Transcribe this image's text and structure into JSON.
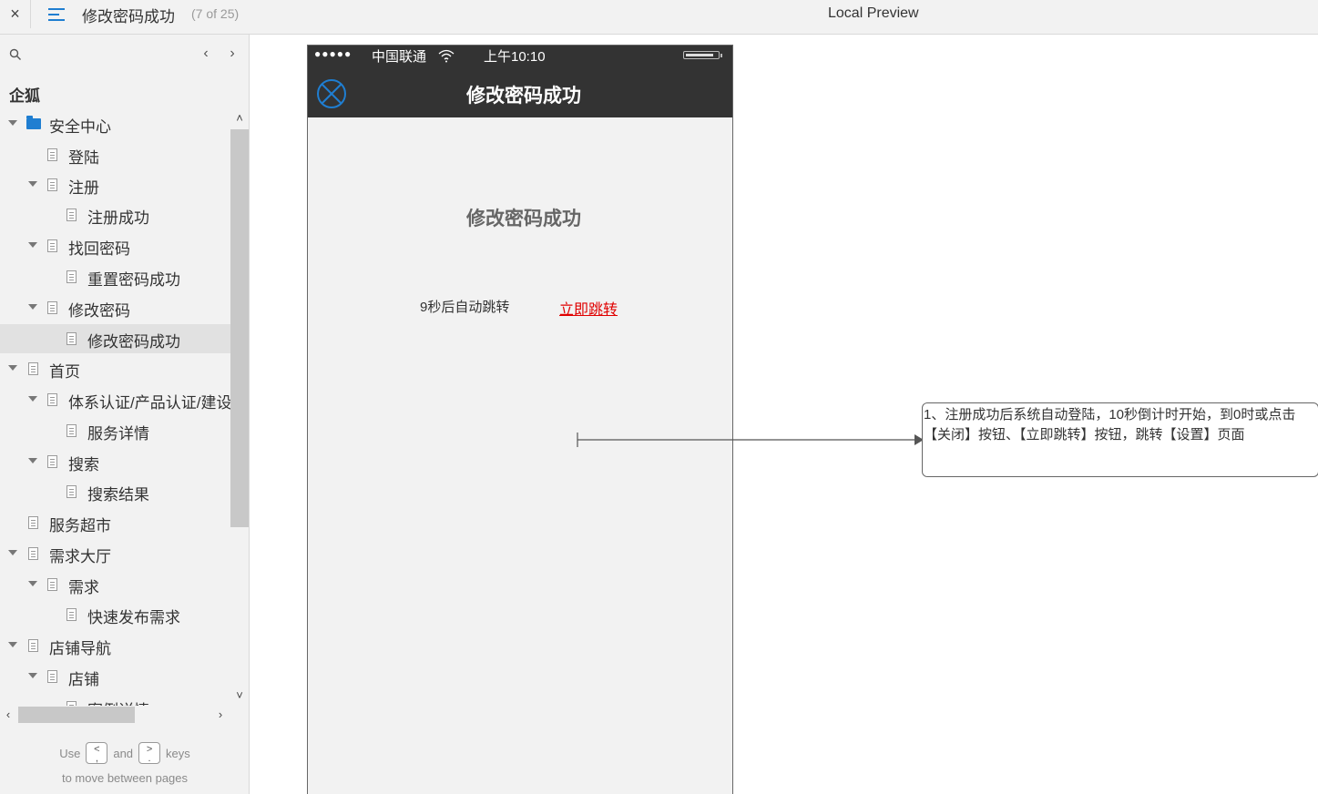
{
  "topbar": {
    "close_label": "×",
    "page_title": "修改密码成功",
    "page_count": "(7 of 25)",
    "preview_label": "Local Preview"
  },
  "sidebar": {
    "nav_prev": "‹",
    "nav_next": "›",
    "project_name": "企狐",
    "tree": [
      {
        "label": "安全中心"
      },
      {
        "label": "登陆"
      },
      {
        "label": "注册"
      },
      {
        "label": "注册成功"
      },
      {
        "label": "找回密码"
      },
      {
        "label": "重置密码成功"
      },
      {
        "label": "修改密码"
      },
      {
        "label": "修改密码成功"
      },
      {
        "label": "首页"
      },
      {
        "label": "体系认证/产品认证/建设"
      },
      {
        "label": "服务详情"
      },
      {
        "label": "搜索"
      },
      {
        "label": "搜索结果"
      },
      {
        "label": "服务超市"
      },
      {
        "label": "需求大厅"
      },
      {
        "label": "需求"
      },
      {
        "label": "快速发布需求"
      },
      {
        "label": "店铺导航"
      },
      {
        "label": "店铺"
      },
      {
        "label": "案例详情"
      }
    ],
    "hint": {
      "use": "Use",
      "key_prev": "<\n,",
      "and": "and",
      "key_next": ">\n.",
      "keys": "keys",
      "line2": "to move between pages"
    }
  },
  "phone": {
    "status": {
      "dots": "●●●●●",
      "carrier": "中国联通",
      "time": "上午10:10"
    },
    "nav_title": "修改密码成功",
    "success_title": "修改密码成功",
    "countdown": "9秒后自动跳转",
    "jump_link": "立即跳转"
  },
  "note": {
    "text": "1、注册成功后系统自动登陆，10秒倒计时开始，到0时或点击【关闭】按钮、【立即跳转】按钮，跳转【设置】页面"
  },
  "colors": {
    "accent": "#1f7ed1",
    "phone_bar": "#333333",
    "link_red": "#e00000",
    "sidebar_bg": "#f2f2f2"
  }
}
